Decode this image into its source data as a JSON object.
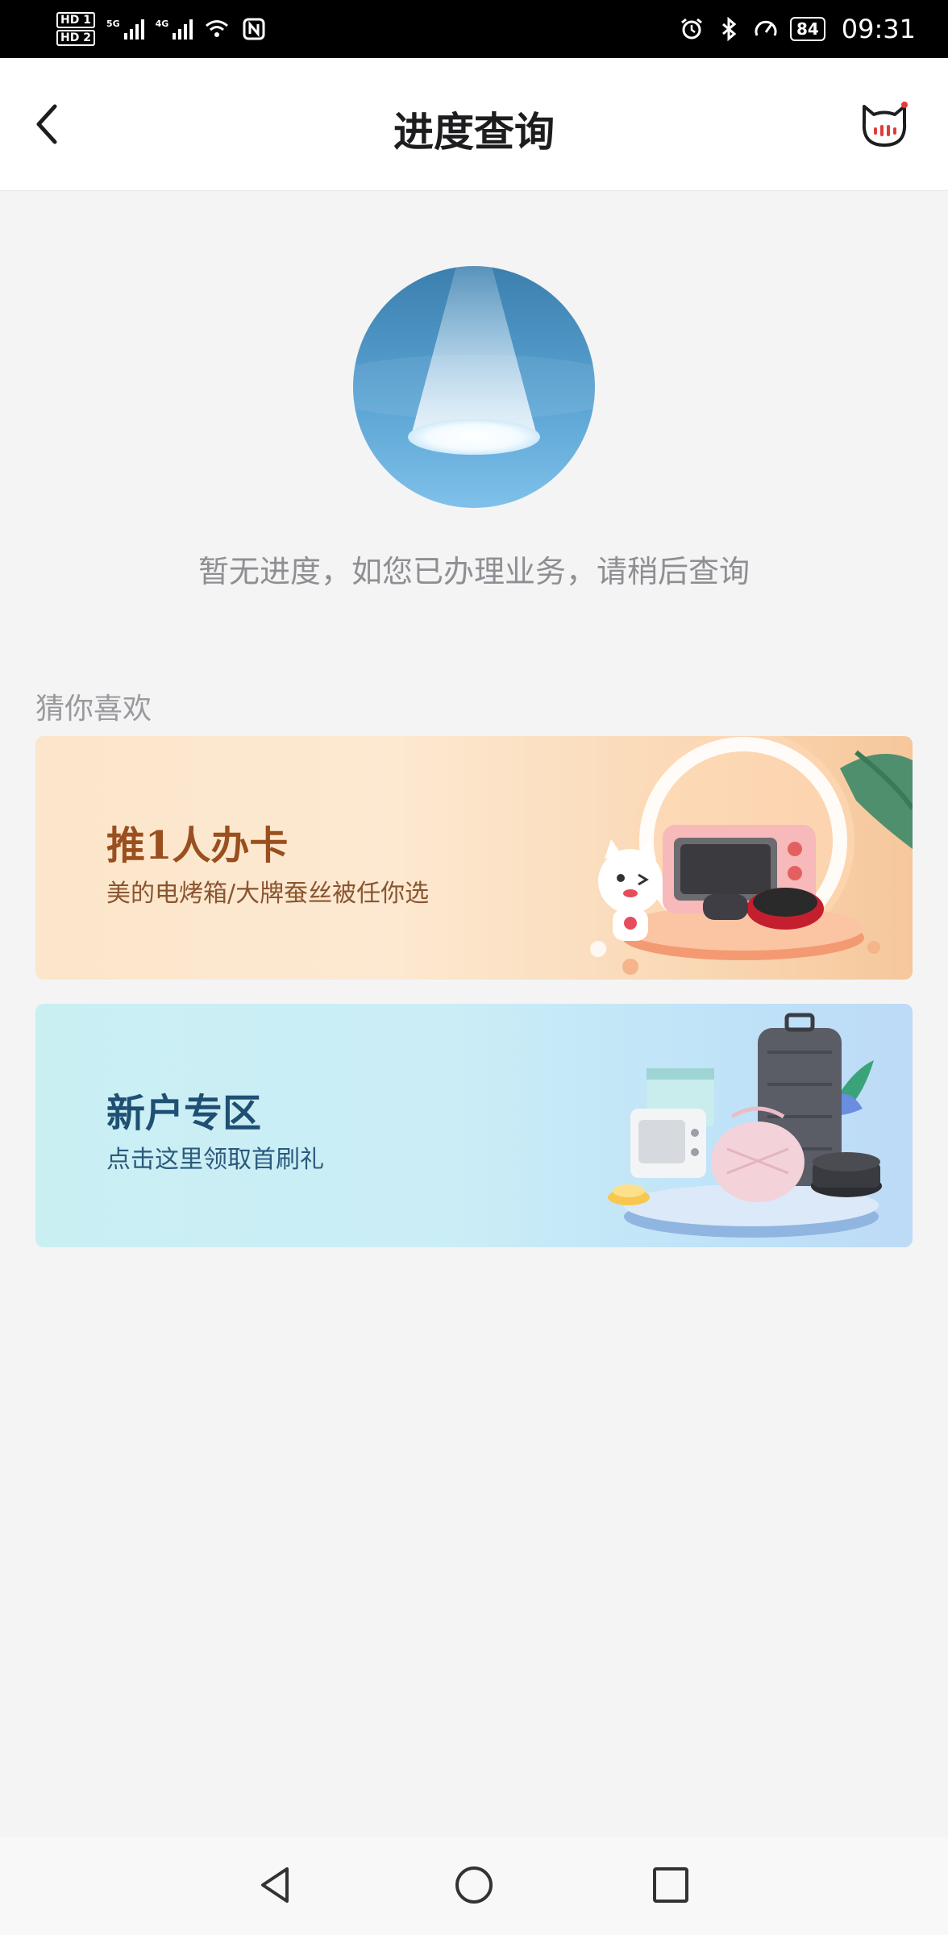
{
  "status_bar": {
    "hd1": "HD 1",
    "hd2": "HD 2",
    "net1": "5G",
    "net2": "4G",
    "battery": "84",
    "time": "09:31"
  },
  "nav": {
    "title": "进度查询"
  },
  "empty_state": {
    "message": "暂无进度，如您已办理业务，请稍后查询"
  },
  "recommend": {
    "section_title": "猜你喜欢",
    "banners": [
      {
        "title": "推1人办卡",
        "subtitle": "美的电烤箱/大牌蚕丝被任你选"
      },
      {
        "title": "新户专区",
        "subtitle": "点击这里领取首刷礼"
      }
    ]
  },
  "colors": {
    "page_bg": "#f4f4f5",
    "title": "#1d1d1f",
    "muted_text": "#8e8e93",
    "banner1_title": "#9a4f1f",
    "banner2_title": "#1f4f73"
  }
}
